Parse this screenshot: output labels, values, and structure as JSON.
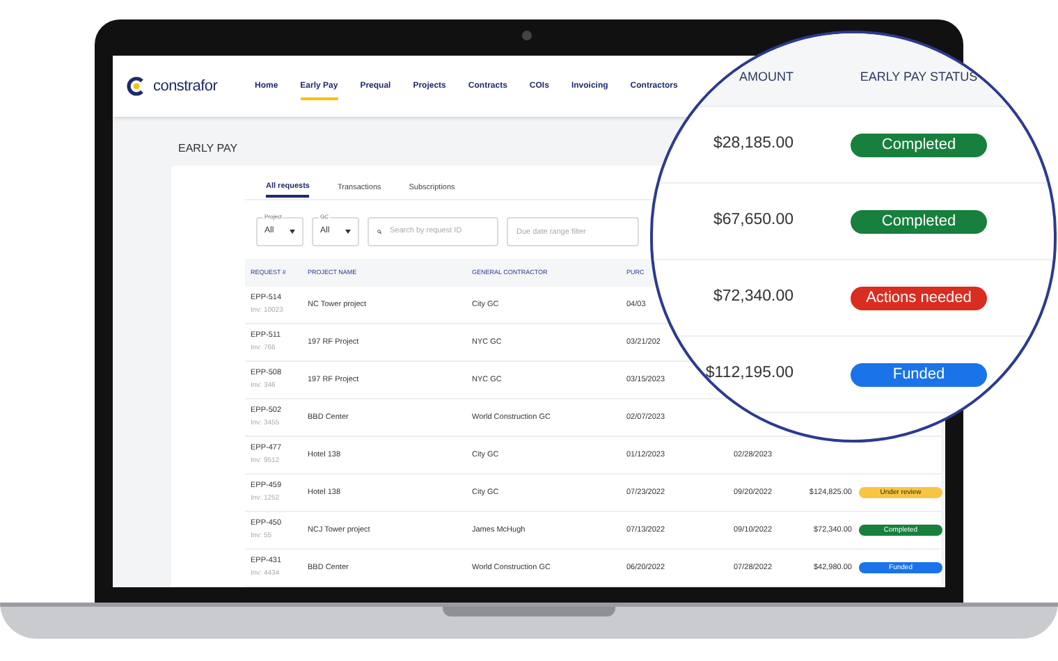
{
  "logo": {
    "text": "constrafor"
  },
  "nav": [
    {
      "label": "Home",
      "selected": false
    },
    {
      "label": "Early Pay",
      "selected": true
    },
    {
      "label": "Prequal",
      "selected": false
    },
    {
      "label": "Projects",
      "selected": false
    },
    {
      "label": "Contracts",
      "selected": false
    },
    {
      "label": "COIs",
      "selected": false
    },
    {
      "label": "Invoicing",
      "selected": false
    },
    {
      "label": "Contractors",
      "selected": false
    }
  ],
  "page_title": "EARLY PAY",
  "tabs": [
    {
      "label": "All requests",
      "selected": true
    },
    {
      "label": "Transactions",
      "selected": false
    },
    {
      "label": "Subscriptions",
      "selected": false
    }
  ],
  "filters": {
    "project": {
      "label": "Project",
      "value": "All"
    },
    "gc": {
      "label": "GC",
      "value": "All"
    },
    "search": {
      "placeholder": "Search by request ID"
    },
    "date_range": {
      "placeholder": "Due date range filter"
    }
  },
  "table": {
    "columns": [
      "REQUEST #",
      "PROJECT NAME",
      "GENERAL CONTRACTOR",
      "PURC"
    ],
    "rows": [
      {
        "request": "EPP-514",
        "invoice": "Inv: 10023",
        "project": "NC Tower project",
        "contractor": "City GC",
        "date_1": "04/03"
      },
      {
        "request": "EPP-511",
        "invoice": "Inv: 766",
        "project": "197 RF Project",
        "contractor": "NYC GC",
        "date_1": "03/21/202"
      },
      {
        "request": "EPP-508",
        "invoice": "Inv: 346",
        "project": "197 RF Project",
        "contractor": "NYC GC",
        "date_1": "03/15/2023"
      },
      {
        "request": "EPP-502",
        "invoice": "Inv: 3455",
        "project": "BBD Center",
        "contractor": "World Construction GC",
        "date_1": "02/07/2023"
      },
      {
        "request": "EPP-477",
        "invoice": "Inv: 9512",
        "project": "Hotel 138",
        "contractor": "City GC",
        "date_1": "01/12/2023",
        "date_2": "02/28/2023"
      },
      {
        "request": "EPP-459",
        "invoice": "Inv: 1252",
        "project": "Hotel 138",
        "contractor": "City GC",
        "date_1": "07/23/2022",
        "date_2": "09/20/2022",
        "amount": "$124,825.00",
        "status": {
          "label": "Under review",
          "kind": "review"
        }
      },
      {
        "request": "EPP-450",
        "invoice": "Inv: 55",
        "project": "NCJ Tower project",
        "contractor": "James McHugh",
        "date_1": "07/13/2022",
        "date_2": "09/10/2022",
        "amount": "$72,340.00",
        "status": {
          "label": "Completed",
          "kind": "completed"
        }
      },
      {
        "request": "EPP-431",
        "invoice": "Inv: 4434",
        "project": "BBD Center",
        "contractor": "World Construction GC",
        "date_1": "06/20/2022",
        "date_2": "07/28/2022",
        "amount": "$42,980.00",
        "status": {
          "label": "Funded",
          "kind": "funded"
        }
      }
    ]
  },
  "magnifier": {
    "columns": [
      "AMOUNT",
      "EARLY PAY STATUS"
    ],
    "rows": [
      {
        "amount": "$28,185.00",
        "status": {
          "label": "Completed",
          "kind": "completed"
        }
      },
      {
        "amount": "$67,650.00",
        "status": {
          "label": "Completed",
          "kind": "completed"
        }
      },
      {
        "amount": "$72,340.00",
        "status": {
          "label": "Actions needed",
          "kind": "actions"
        }
      },
      {
        "amount": "$112,195.00",
        "status": {
          "label": "Funded",
          "kind": "funded"
        }
      }
    ]
  }
}
